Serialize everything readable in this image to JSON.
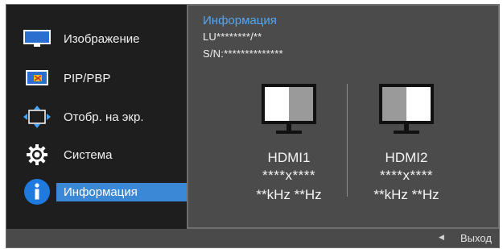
{
  "menu": {
    "items": [
      {
        "label": "Изображение",
        "icon": "picture-monitor-icon"
      },
      {
        "label": "PIP/PBP",
        "icon": "pip-pbp-icon"
      },
      {
        "label": "Отобр. на экр.",
        "icon": "onscreen-display-icon"
      },
      {
        "label": "Система",
        "icon": "gear-icon"
      },
      {
        "label": "Информация",
        "icon": "info-icon",
        "active": true
      }
    ]
  },
  "info": {
    "title": "Информация",
    "model": "LU********/**",
    "serial": "S/N:**************",
    "sources": [
      {
        "name": "HDMI1",
        "resolution": "****x****",
        "frequency": "**kHz **Hz"
      },
      {
        "name": "HDMI2",
        "resolution": "****x****",
        "frequency": "**kHz **Hz"
      }
    ]
  },
  "footer": {
    "exit_label": "Выход"
  },
  "colors": {
    "accent": "#3b88d6",
    "title": "#56a5f0",
    "panel": "#4b4b4b",
    "background": "#1e1e1e"
  }
}
